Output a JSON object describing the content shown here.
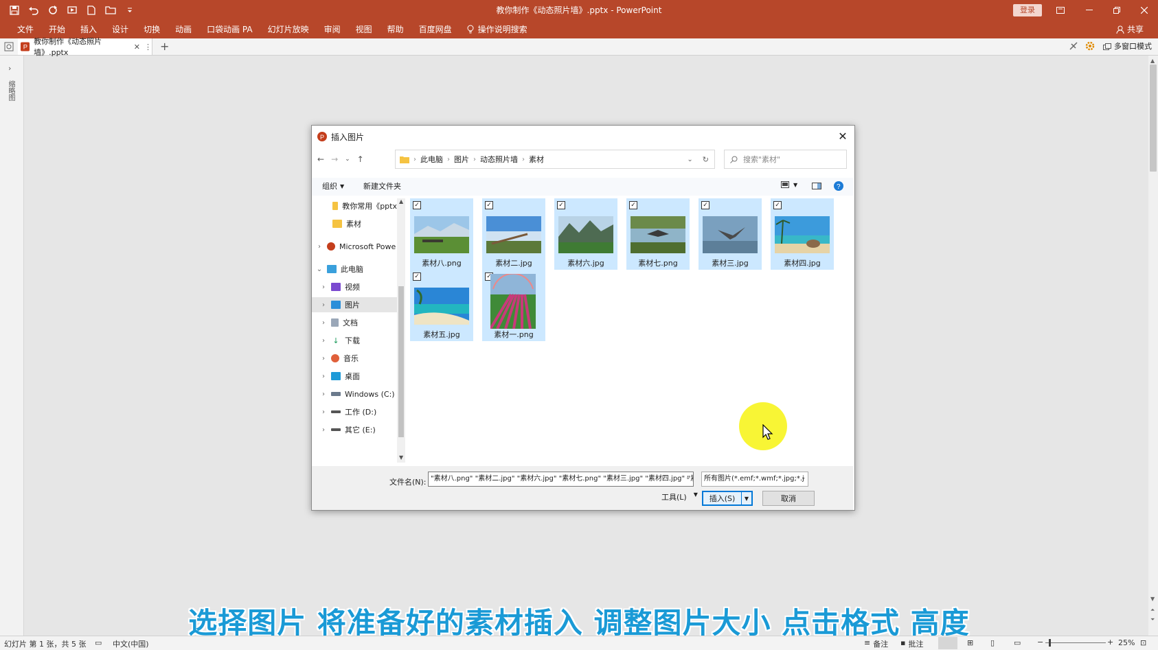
{
  "window": {
    "title": "教你制作《动态照片墙》.pptx - PowerPoint",
    "login": "登录"
  },
  "ribbon": {
    "tabs": [
      "文件",
      "开始",
      "插入",
      "设计",
      "切换",
      "动画",
      "口袋动画 PA",
      "幻灯片放映",
      "审阅",
      "视图",
      "帮助",
      "百度网盘",
      "操作说明搜索"
    ],
    "share": "共享"
  },
  "tabbar": {
    "doc_tab": "教你制作《动态照片墙》.pptx",
    "multi_window": "多窗口模式"
  },
  "left_pane": {
    "label": "缩略图"
  },
  "dialog": {
    "title": "插入图片",
    "breadcrumb": [
      "此电脑",
      "图片",
      "动态照片墙",
      "素材"
    ],
    "search_placeholder": "搜索\"素材\"",
    "organize": "组织",
    "new_folder": "新建文件夹",
    "nav_items": [
      {
        "label": "教你常用《pptx",
        "icon": "folder-icon"
      },
      {
        "label": "素材",
        "icon": "folder-icon"
      },
      {
        "label": "Microsoft Powe",
        "icon": "powerpoint-icon"
      },
      {
        "label": "此电脑",
        "icon": "computer-icon"
      },
      {
        "label": "视频",
        "icon": "video-icon"
      },
      {
        "label": "图片",
        "icon": "pictures-icon"
      },
      {
        "label": "文档",
        "icon": "documents-icon"
      },
      {
        "label": "下载",
        "icon": "download-icon"
      },
      {
        "label": "音乐",
        "icon": "music-icon"
      },
      {
        "label": "桌面",
        "icon": "desktop-icon"
      },
      {
        "label": "Windows (C:)",
        "icon": "drive-icon"
      },
      {
        "label": "工作 (D:)",
        "icon": "drive-icon"
      },
      {
        "label": "其它 (E:)",
        "icon": "drive-icon"
      }
    ],
    "files": [
      {
        "name": "素材八.png",
        "checked": true
      },
      {
        "name": "素材二.jpg",
        "checked": true
      },
      {
        "name": "素材六.jpg",
        "checked": true
      },
      {
        "name": "素材七.png",
        "checked": true
      },
      {
        "name": "素材三.jpg",
        "checked": true
      },
      {
        "name": "素材四.jpg",
        "checked": true
      },
      {
        "name": "素材五.jpg",
        "checked": true
      },
      {
        "name": "素材一.png",
        "checked": true
      }
    ],
    "filename_label": "文件名(N):",
    "filename_value": "\"素材八.png\" \"素材二.jpg\" \"素材六.jpg\" \"素材七.png\" \"素材三.jpg\" \"素材四.jpg\" \"素材",
    "filetype_value": "所有图片(*.emf;*.wmf;*.jpg;*.j",
    "tools": "工具(L)",
    "insert": "插入(S)",
    "cancel": "取消"
  },
  "caption": "选择图片 将准备好的素材插入 调整图片大小 点击格式 高度",
  "status": {
    "slide": "幻灯片 第 1 张，共 5 张",
    "language": "中文(中国)",
    "notes": "备注",
    "comments": "批注",
    "zoom": "25%"
  },
  "colors": {
    "accent": "#b7472a",
    "caption": "#1a9ad6",
    "selection": "#cce8ff",
    "highlight": "#f7f312"
  }
}
